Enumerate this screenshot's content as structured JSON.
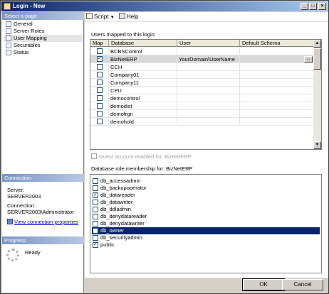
{
  "window": {
    "title": "Login - New",
    "controls": {
      "minimize": "_",
      "maximize": "□",
      "close": "×"
    }
  },
  "left": {
    "select_page_header": "Select a page",
    "pages": [
      "General",
      "Server Roles",
      "User Mapping",
      "Securables",
      "Status"
    ],
    "selected_page": "User Mapping",
    "connection_header": "Connection",
    "server_label": "Server:",
    "server_value": "SERVER2003",
    "connection_label": "Connection:",
    "connection_value": "SERVER2003\\Administrator",
    "view_connection_link": "View connection properties",
    "progress_header": "Progress",
    "progress_status": "Ready"
  },
  "toolbar": {
    "script_label": "Script",
    "help_label": "Help"
  },
  "users_mapped": {
    "label": "Users mapped to this login:",
    "columns": [
      "Map",
      "Database",
      "User",
      "Default Schema"
    ],
    "rows": [
      {
        "map": false,
        "database": "BCBSControl",
        "user": "",
        "schema": ""
      },
      {
        "map": true,
        "database": "BizNetERP",
        "user": "YourDomain\\UserName",
        "schema": "",
        "selected": true
      },
      {
        "map": false,
        "database": "CCH",
        "user": "",
        "schema": ""
      },
      {
        "map": false,
        "database": "Company01",
        "user": "",
        "schema": ""
      },
      {
        "map": false,
        "database": "Company11",
        "user": "",
        "schema": ""
      },
      {
        "map": false,
        "database": "CPU",
        "user": "",
        "schema": ""
      },
      {
        "map": false,
        "database": "democontrol",
        "user": "",
        "schema": ""
      },
      {
        "map": false,
        "database": "demodist",
        "user": "",
        "schema": ""
      },
      {
        "map": false,
        "database": "demofrgn",
        "user": "",
        "schema": ""
      },
      {
        "map": false,
        "database": "demohold",
        "user": "",
        "schema": ""
      }
    ],
    "ellipsis": "..."
  },
  "guest_account": {
    "label": "Guest account enabled for: BizNetERP",
    "checked": false,
    "enabled": false
  },
  "roles": {
    "label": "Database role membership for: BizNetERP",
    "items": [
      {
        "name": "db_accessadmin",
        "checked": false
      },
      {
        "name": "db_backupoperator",
        "checked": false
      },
      {
        "name": "db_datareader",
        "checked": true
      },
      {
        "name": "db_datawriter",
        "checked": false
      },
      {
        "name": "db_ddladmin",
        "checked": false
      },
      {
        "name": "db_denydatareader",
        "checked": false
      },
      {
        "name": "db_denydatawriter",
        "checked": false
      },
      {
        "name": "db_owner",
        "checked": false,
        "selected": true
      },
      {
        "name": "db_securityadmin",
        "checked": false
      },
      {
        "name": "public",
        "checked": true
      }
    ]
  },
  "buttons": {
    "ok": "OK",
    "cancel": "Cancel"
  },
  "colors": {
    "title_start": "#0a246a",
    "title_end": "#a6caf0",
    "section_header": "#7a96c4",
    "selection": "#0a246a",
    "window_bg": "#d4d0c8"
  }
}
